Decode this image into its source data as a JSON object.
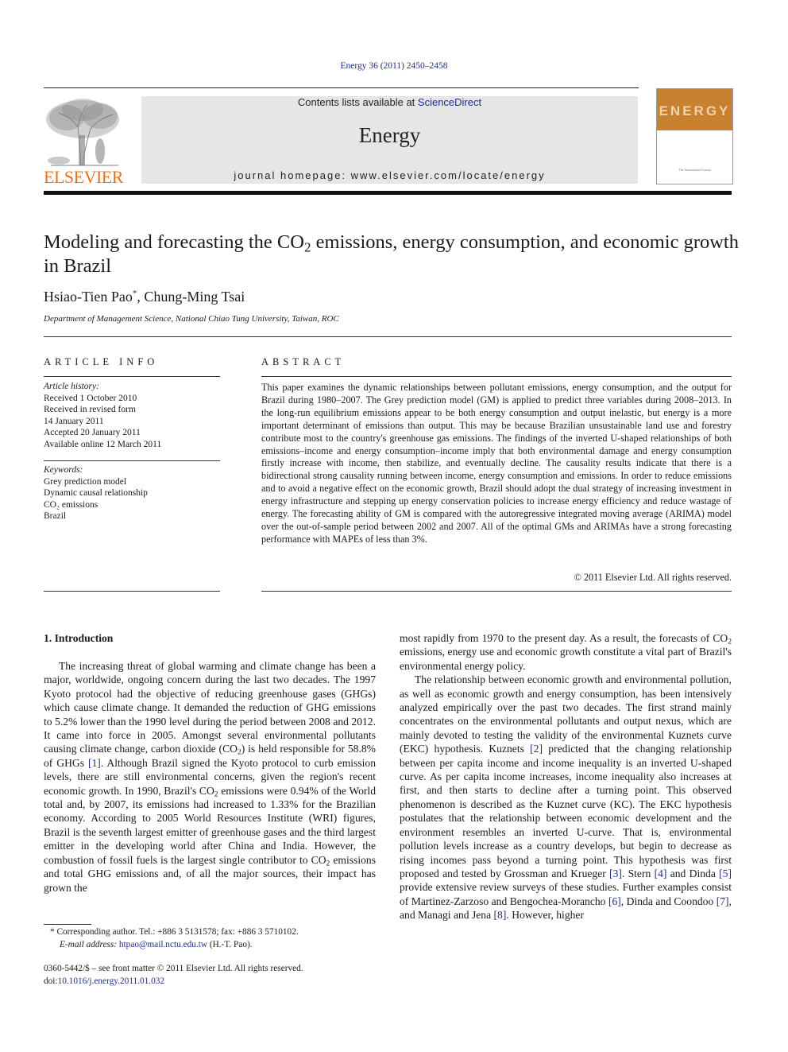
{
  "header": {
    "journal_ref": "Energy 36 (2011) 2450–2458",
    "contents_prefix": "Contents lists available at ",
    "contents_link": "ScienceDirect",
    "journal_name": "Energy",
    "homepage": "journal homepage: www.elsevier.com/locate/energy",
    "publisher_logo_text": "ELSEVIER",
    "cover_word": "ENERGY",
    "cover_caption": "The International Journal",
    "colors": {
      "brand_orange": "#e9711c",
      "link_blue": "#1f2d8a",
      "cover_orange": "#c8812f",
      "banner_gray": "#e6e6e6"
    }
  },
  "article": {
    "title_part1": "Modeling and forecasting the CO",
    "title_sub": "2",
    "title_part2": " emissions, energy consumption, and economic growth in Brazil",
    "author1": "Hsiao-Tien Pao",
    "author1_mark": "*",
    "author_sep": ", ",
    "author2": "Chung-Ming Tsai",
    "affiliation": "Department of Management Science, National Chiao Tung University, Taiwan, ROC"
  },
  "article_info": {
    "heading": "ARTICLE INFO",
    "history_label": "Article history:",
    "history": [
      "Received 1 October 2010",
      "Received in revised form",
      "14 January 2011",
      "Accepted 20 January 2011",
      "Available online 12 March 2011"
    ],
    "keywords_label": "Keywords:",
    "keywords": [
      "Grey prediction model",
      "Dynamic causal relationship",
      "CO₂ emissions",
      "Brazil"
    ]
  },
  "abstract": {
    "heading": "ABSTRACT",
    "text": "This paper examines the dynamic relationships between pollutant emissions, energy consumption, and the output for Brazil during 1980–2007. The Grey prediction model (GM) is applied to predict three variables during 2008–2013. In the long-run equilibrium emissions appear to be both energy consumption and output inelastic, but energy is a more important determinant of emissions than output. This may be because Brazilian unsustainable land use and forestry contribute most to the country's greenhouse gas emissions. The findings of the inverted U-shaped relationships of both emissions–income and energy consumption–income imply that both environmental damage and energy consumption firstly increase with income, then stabilize, and eventually decline. The causality results indicate that there is a bidirectional strong causality running between income, energy consumption and emissions. In order to reduce emissions and to avoid a negative effect on the economic growth, Brazil should adopt the dual strategy of increasing investment in energy infrastructure and stepping up energy conservation policies to increase energy efficiency and reduce wastage of energy. The forecasting ability of GM is compared with the autoregressive integrated moving average (ARIMA) model over the out-of-sample period between 2002 and 2007. All of the optimal GMs and ARIMAs have a strong forecasting performance with MAPEs of less than 3%.",
    "copyright": "© 2011 Elsevier Ltd. All rights reserved."
  },
  "body": {
    "intro_heading": "1.  Introduction",
    "left_p1_a": "The increasing threat of global warming and climate change has been a major, worldwide, ongoing concern during the last two decades. The 1997 Kyoto protocol had the objective of reducing greenhouse gases (GHGs) which cause climate change. It demanded the reduction of GHG emissions to 5.2% lower than the 1990 level during the period between 2008 and 2012. It came into force in 2005. Amongst several environmental pollutants causing climate change, carbon dioxide (CO",
    "left_p1_b": ") is held responsible for 58.8% of GHGs ",
    "ref1": "[1]",
    "left_p1_c": ". Although Brazil signed the Kyoto protocol to curb emission levels, there are still environmental concerns, given the region's recent economic growth. In 1990, Brazil's CO",
    "left_p1_d": " emissions were 0.94% of the World total and, by 2007, its emissions had increased to 1.33% for the Brazilian economy. According to 2005 World Resources Institute (WRI) figures, Brazil is the seventh largest emitter of greenhouse gases and the third largest emitter in the developing world after China and India. However, the combustion of fossil fuels is the largest single contributor to CO",
    "left_p1_e": " emissions and total GHG emissions and, of all the major sources, their impact has grown the",
    "right_p1_a": "most rapidly from 1970 to the present day. As a result, the forecasts of CO",
    "right_p1_b": " emissions, energy use and economic growth constitute a vital part of Brazil's environmental energy policy.",
    "right_p2_a": "The relationship between economic growth and environmental pollution, as well as economic growth and energy consumption, has been intensively analyzed empirically over the past two decades. The first strand mainly concentrates on the environmental pollutants and output nexus, which are mainly devoted to testing the validity of the environmental Kuznets curve (EKC) hypothesis. Kuznets ",
    "ref2": "[2]",
    "right_p2_b": " predicted that the changing relationship between per capita income and income inequality is an inverted U-shaped curve. As per capita income increases, income inequality also increases at first, and then starts to decline after a turning point. This observed phenomenon is described as the Kuznet curve (KC). The EKC hypothesis postulates that the relationship between economic development and the environment resembles an inverted U-curve. That is, environmental pollution levels increase as a country develops, but begin to decrease as rising incomes pass beyond a turning point. This hypothesis was first proposed and tested by Grossman and Krueger ",
    "ref3": "[3]",
    "right_p2_c": ". Stern ",
    "ref4": "[4]",
    "right_p2_d": " and Dinda ",
    "ref5": "[5]",
    "right_p2_e": " provide extensive review surveys of these studies. Further examples consist of Martinez-Zarzoso and Bengochea-Morancho ",
    "ref6": "[6]",
    "right_p2_f": ", Dinda and Coondoo ",
    "ref7": "[7]",
    "right_p2_g": ", and Managi and Jena ",
    "ref8": "[8]",
    "right_p2_h": ". However, higher",
    "sub2": "2"
  },
  "footnote": {
    "mark": "*",
    "text": " Corresponding author. Tel.: +886 3 5131578; fax: +886 3 5710102.",
    "email_label": "E-mail address: ",
    "email": "htpao@mail.nctu.edu.tw",
    "email_suffix": " (H.-T. Pao)."
  },
  "front_matter": {
    "issn_line": "0360-5442/$ – see front matter © 2011 Elsevier Ltd. All rights reserved.",
    "doi_label": "doi:",
    "doi": "10.1016/j.energy.2011.01.032"
  }
}
